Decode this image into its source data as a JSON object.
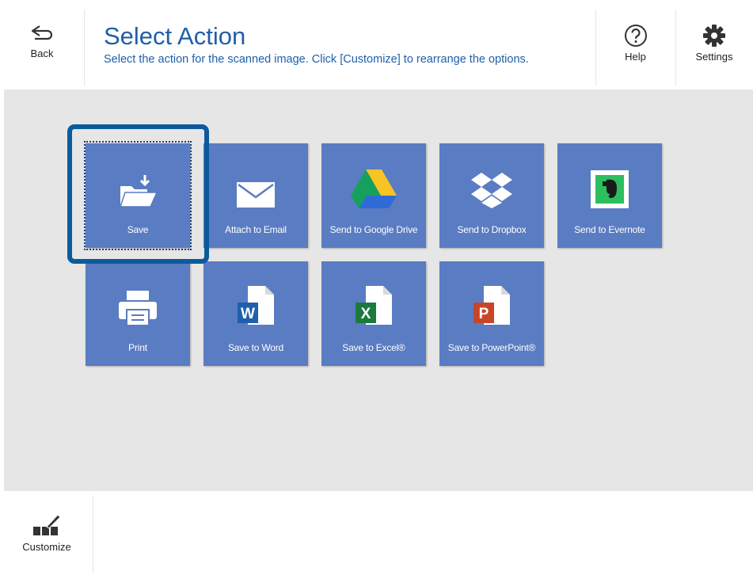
{
  "header": {
    "back_label": "Back",
    "title": "Select Action",
    "subtitle": "Select the action for the scanned image. Click [Customize] to rearrange the options.",
    "help_label": "Help",
    "settings_label": "Settings"
  },
  "tiles": [
    {
      "label": "Save",
      "icon": "folder-save-icon",
      "selected": true
    },
    {
      "label": "Attach to Email",
      "icon": "envelope-icon"
    },
    {
      "label": "Send to Google Drive",
      "icon": "google-drive-icon"
    },
    {
      "label": "Send to Dropbox",
      "icon": "dropbox-icon"
    },
    {
      "label": "Send to Evernote",
      "icon": "evernote-icon"
    },
    {
      "label": "Print",
      "icon": "printer-icon"
    },
    {
      "label": "Save to Word",
      "icon": "word-doc-icon"
    },
    {
      "label": "Save to Excel®",
      "icon": "excel-doc-icon"
    },
    {
      "label": "Save to PowerPoint®",
      "icon": "powerpoint-doc-icon"
    }
  ],
  "footer": {
    "customize_label": "Customize"
  },
  "colors": {
    "accent": "#1f5fa8",
    "tile": "#5a7cc2",
    "focus": "#0b5b9c",
    "background": "#e6e6e6"
  }
}
